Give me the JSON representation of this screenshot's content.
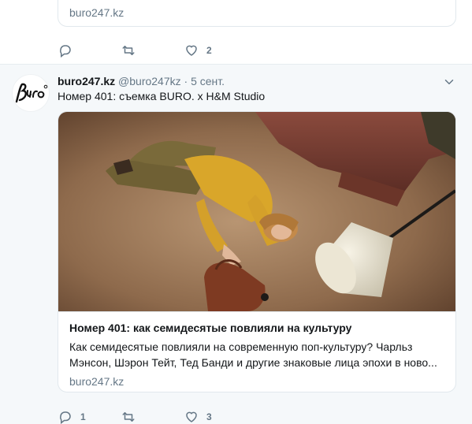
{
  "previous_tweet": {
    "card_domain": "buro247.kz",
    "actions": {
      "reply_count": "",
      "retweet_count": "",
      "like_count": "2"
    }
  },
  "tweet": {
    "name": "buro247.kz",
    "handle": "@buro247kz",
    "dot": "·",
    "date": "5 сент.",
    "text": "Номер 401: съемка BURO. x H&M Studio",
    "card": {
      "title": "Номер 401: как семидесятые повлияли на культуру",
      "description": "Как семидесятые повлияли на современную поп-культуру? Чарльз Мэнсон, Шэрон Тейт, Тед Банди и другие знаковые лица эпохи в ново...",
      "domain": "buro247.kz"
    },
    "actions": {
      "reply_count": "1",
      "retweet_count": "",
      "like_count": "3"
    }
  },
  "icons": {
    "reply": "reply-icon",
    "retweet": "retweet-icon",
    "like": "heart-icon",
    "more": "chevron-down-icon",
    "avatar_logo": "buro-logo"
  },
  "colors": {
    "muted": "#657786",
    "background": "#f5f8fa",
    "border": "#e1e8ed"
  }
}
